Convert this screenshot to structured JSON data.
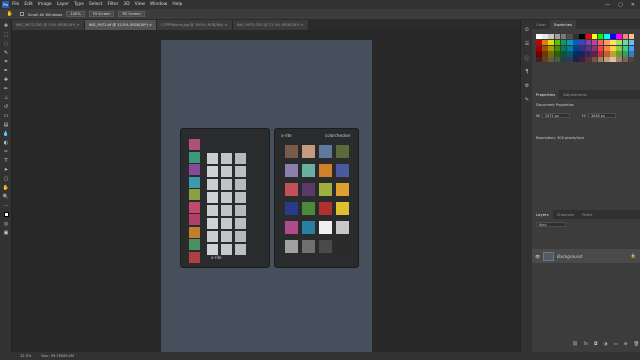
{
  "menubar": {
    "logo": "Ps",
    "items": [
      "File",
      "Edit",
      "Image",
      "Layer",
      "Type",
      "Select",
      "Filter",
      "3D",
      "View",
      "Window",
      "Help"
    ],
    "window_controls": [
      "—",
      "▢",
      "✕"
    ]
  },
  "options_bar": {
    "scroll_all_windows": "Scroll All Windows",
    "zoom": "100%",
    "fit_screen": "Fit Screen",
    "fill_screen": "Fill Screen"
  },
  "tabs": [
    {
      "label": "IMG_9972.CR2 @ 15% (RGB/16*) ×",
      "active": false
    },
    {
      "label": "IMG_9972.tif @ 12.5% (RGB/16*) ×",
      "active": true
    },
    {
      "label": "CCPPRbkrnt.jpg @ 100% (RGB/8#) ×",
      "active": false
    },
    {
      "label": "IMG_9972.CR2 @ 12.5% (RGB/16*) ×",
      "active": false
    }
  ],
  "checker": {
    "brand_left": "x-rite",
    "brand_right": "x-rite",
    "product": "colorchecker",
    "left_colors": [
      "#b0507a",
      "#3a9a7a",
      "#8a4a9a",
      "#3a9ab0",
      "#8aa040",
      "#c04a6a",
      "#b0406a",
      "#c0802a",
      "#4a9060",
      "#b04040"
    ],
    "right_colors": [
      "#7a5a4a",
      "#c49a80",
      "#5e7a9a",
      "#5a6a3a",
      "#8a80b0",
      "#6ab0a0",
      "#d0802a",
      "#4a5aa0",
      "#c0505a",
      "#5a3a6a",
      "#a0b040",
      "#e0a030",
      "#2a3a8a",
      "#4a8a3a",
      "#b03030",
      "#e0c030",
      "#b04a8a",
      "#2a80a0",
      "#f0f0f0",
      "#c8c8c8",
      "#a0a0a0",
      "#707070",
      "#4a4a4a",
      "#2a2a2a"
    ]
  },
  "status": {
    "zoom": "12.5%",
    "doc": "Doc: 99.2M/99.2M"
  },
  "panels": {
    "top_tabs": [
      "Color",
      "Swatches"
    ],
    "properties_tabs": [
      "Properties",
      "Adjustments"
    ],
    "properties_title": "Document Properties",
    "w_label": "W:",
    "w_value": "5472 px",
    "h_label": "H:",
    "h_value": "3648 px",
    "resolution": "Resolution: 300 pixels/inch",
    "layers_tabs": [
      "Layers",
      "Channels",
      "Paths"
    ],
    "kind_label": "Kind",
    "layer_name": "Background",
    "swatch_colors": [
      "#ffffff",
      "#e6e6e6",
      "#c8c8c8",
      "#a0a0a0",
      "#787878",
      "#505050",
      "#303030",
      "#000000",
      "#ff0000",
      "#ffff00",
      "#00ff00",
      "#00ffff",
      "#0000ff",
      "#ff00ff",
      "#ff8080",
      "#ffc080",
      "#c80000",
      "#e08000",
      "#e0e000",
      "#60c000",
      "#00a060",
      "#00a0c0",
      "#0060c0",
      "#4040c0",
      "#8040c0",
      "#c040a0",
      "#ff6060",
      "#ffa060",
      "#ffe060",
      "#a0e060",
      "#60e0a0",
      "#60c0ff",
      "#a00000",
      "#a05000",
      "#a0a000",
      "#409000",
      "#008050",
      "#0080a0",
      "#004090",
      "#303090",
      "#603090",
      "#903070",
      "#ff4040",
      "#ff8040",
      "#ffd040",
      "#80d040",
      "#40d080",
      "#40a0ff",
      "#700000",
      "#703800",
      "#707000",
      "#306000",
      "#005a3a",
      "#005a70",
      "#003060",
      "#202060",
      "#402060",
      "#602050",
      "#c03030",
      "#c06030",
      "#c0a030",
      "#60a030",
      "#30a060",
      "#3080c0",
      "#402020",
      "#604020",
      "#606040",
      "#406040",
      "#204040",
      "#204060",
      "#202040",
      "#402040",
      "#603030",
      "#805040",
      "#a08060",
      "#c0a080",
      "#e0c0a0",
      "#a08070",
      "#806050",
      "#604030"
    ]
  }
}
